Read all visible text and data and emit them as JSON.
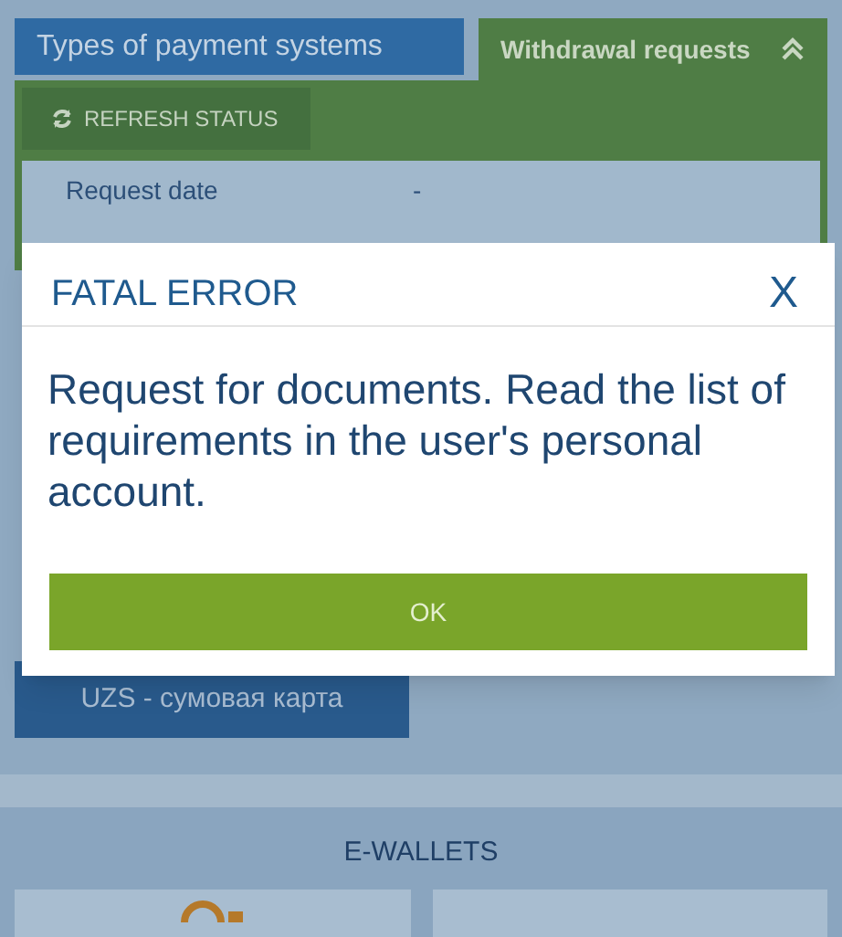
{
  "tabs": [
    {
      "label": "Types of payment systems",
      "selected": false
    },
    {
      "label": "Withdrawal requests",
      "selected": true,
      "expanded": true
    }
  ],
  "refresh_button": "REFRESH STATUS",
  "request_rows": [
    {
      "label": "Request date",
      "value": "-"
    }
  ],
  "payment_card": "UZS - сумовая карта",
  "section_title": "E-WALLETS",
  "dialog": {
    "title": "FATAL ERROR",
    "close": "X",
    "message": "Request for documents. Read the list of requirements in the user's personal account.",
    "button": "OK"
  }
}
